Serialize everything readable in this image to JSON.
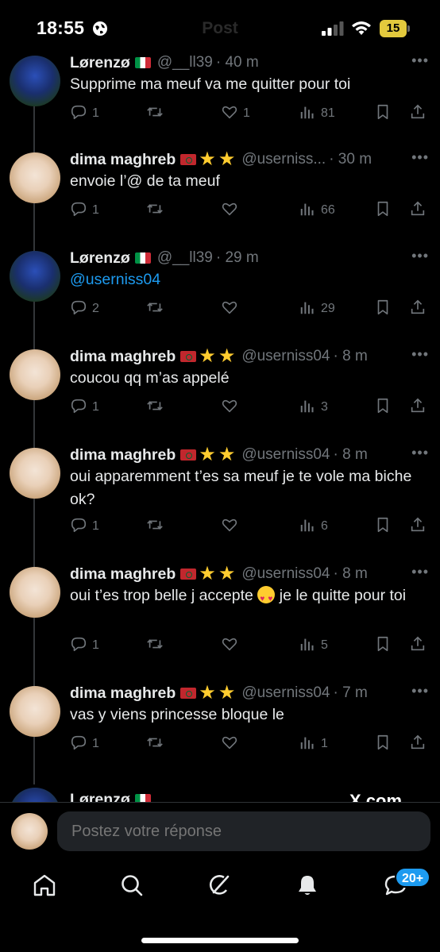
{
  "status_bar": {
    "time": "18:55",
    "title": "Post",
    "battery": "15",
    "icons": [
      "globe-icon",
      "signal-icon",
      "wifi-icon",
      "battery-icon"
    ]
  },
  "tweets": [
    {
      "name": "Lørenzø",
      "flag": "italy",
      "stars": 0,
      "handle": "@__ll39",
      "time": "· 40 m",
      "text": "Supprime ma meuf va me quitter pour toi",
      "replies": "1",
      "likes": "1",
      "views": "81",
      "avatar": "team-photo"
    },
    {
      "name": "dima maghreb",
      "flag": "morocco",
      "stars": 2,
      "handle": "@userniss...",
      "time": "· 30 m",
      "text": "envoie l’@ de ta meuf",
      "replies": "1",
      "likes": "",
      "views": "66",
      "avatar": "girl-photo"
    },
    {
      "name": "Lørenzø",
      "flag": "italy",
      "stars": 0,
      "handle": "@__ll39",
      "time": "· 29 m",
      "text": "@userniss04",
      "replies": "2",
      "likes": "",
      "views": "29",
      "avatar": "team-photo"
    },
    {
      "name": "dima maghreb",
      "flag": "morocco",
      "stars": 2,
      "handle": "@userniss04",
      "time": "· 8 m",
      "text": "coucou qq m’as appelé",
      "replies": "1",
      "likes": "",
      "views": "3",
      "avatar": "girl-photo"
    },
    {
      "name": "dima maghreb",
      "flag": "morocco",
      "stars": 2,
      "handle": "@userniss04",
      "time": "· 8 m",
      "text": "oui apparemment t’es sa meuf je te vole ma biche ok?",
      "replies": "1",
      "likes": "",
      "views": "6",
      "avatar": "girl-photo"
    },
    {
      "name": "dima maghreb",
      "flag": "morocco",
      "stars": 2,
      "handle": "@userniss04",
      "time": "· 8 m",
      "text_before_emoji": "oui t’es trop belle j accepte",
      "text_after_emoji": "je le quitte pour toi",
      "emoji": "heart-eyes-emoji",
      "replies": "1",
      "likes": "",
      "views": "5",
      "avatar": "girl-photo"
    },
    {
      "name": "dima maghreb",
      "flag": "morocco",
      "stars": 2,
      "handle": "@userniss04",
      "time": "· 7 m",
      "text": "vas y viens princesse bloque le",
      "replies": "1",
      "likes": "",
      "views": "1",
      "avatar": "girl-photo"
    }
  ],
  "partial_tweet": {
    "name": "Lørenzø"
  },
  "watermark": "X.com",
  "reply_bar": {
    "placeholder": "Postez votre réponse"
  },
  "tab_bar": {
    "items": [
      "home-icon",
      "search-icon",
      "grok-icon",
      "notifications-icon",
      "messages-icon"
    ],
    "messages_badge": "20+"
  },
  "colors": {
    "background": "#000000",
    "text": "#e7e9ea",
    "secondary": "#71767b",
    "accent": "#1d9bf0",
    "battery": "#e3c93d"
  }
}
